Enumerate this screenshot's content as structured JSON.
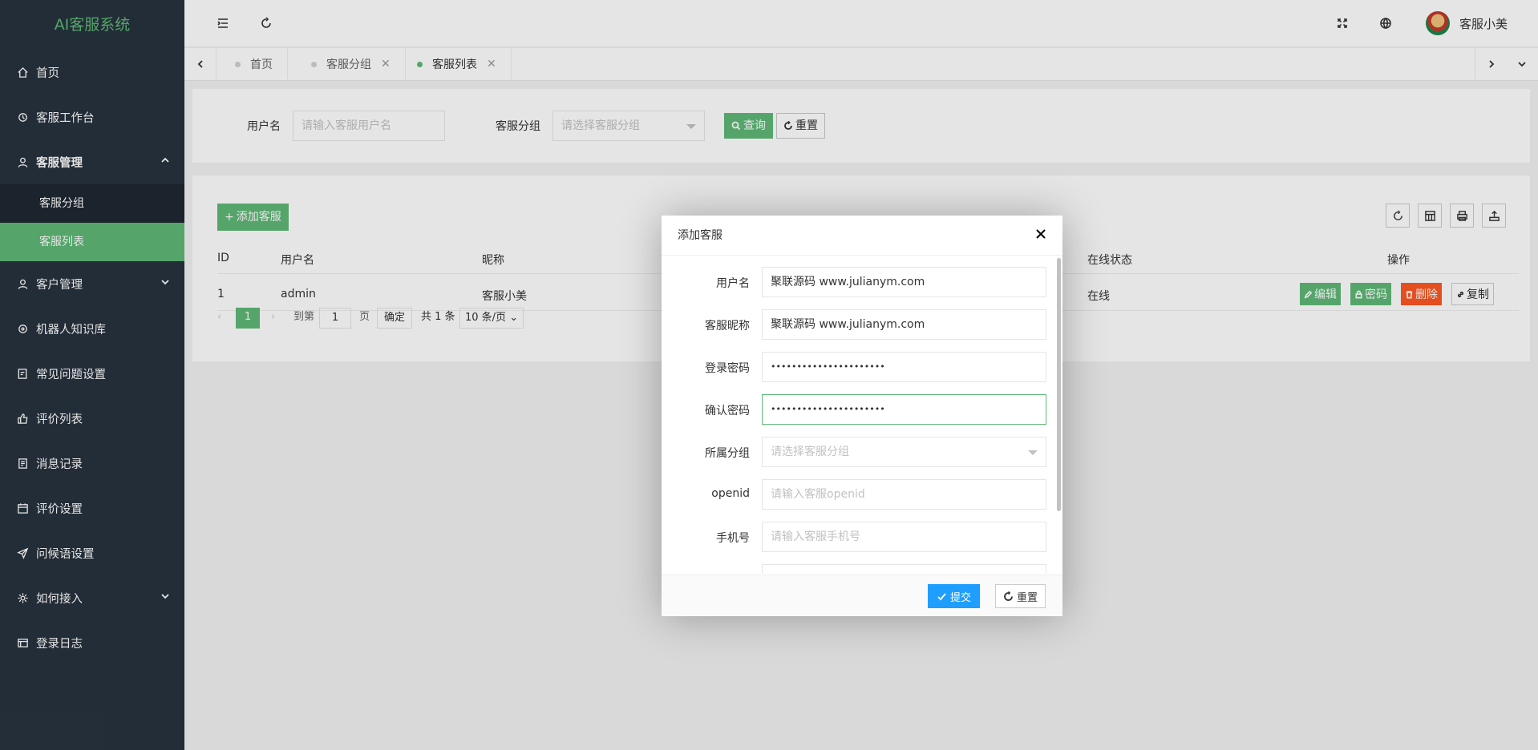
{
  "app": {
    "title": "AI客服系统"
  },
  "sidebar": {
    "items": [
      {
        "label": "首页",
        "icon": "home-icon"
      },
      {
        "label": "客服工作台",
        "icon": "workbench-icon"
      },
      {
        "label": "客服管理",
        "icon": "user-icon",
        "expanded": true,
        "children": [
          {
            "label": "客服分组"
          },
          {
            "label": "客服列表",
            "active": true
          }
        ]
      },
      {
        "label": "客户管理",
        "icon": "user-icon",
        "expanded": false
      },
      {
        "label": "机器人知识库",
        "icon": "robot-icon"
      },
      {
        "label": "常见问题设置",
        "icon": "question-icon"
      },
      {
        "label": "评价列表",
        "icon": "thumb-up-icon"
      },
      {
        "label": "消息记录",
        "icon": "message-icon"
      },
      {
        "label": "评价设置",
        "icon": "calendar-icon"
      },
      {
        "label": "问候语设置",
        "icon": "send-icon"
      },
      {
        "label": "如何接入",
        "icon": "gear-icon",
        "expanded": false
      },
      {
        "label": "登录日志",
        "icon": "log-icon"
      }
    ]
  },
  "header": {
    "user_name": "客服小美"
  },
  "tabs": [
    {
      "label": "首页",
      "closable": false,
      "active": false
    },
    {
      "label": "客服分组",
      "closable": true,
      "active": false
    },
    {
      "label": "客服列表",
      "closable": true,
      "active": true
    }
  ],
  "search": {
    "username_label": "用户名",
    "username_placeholder": "请输入客服用户名",
    "group_label": "客服分组",
    "group_placeholder": "请选择客服分组",
    "query_label": "查询",
    "reset_label": "重置"
  },
  "table": {
    "add_label": "添加客服",
    "columns": [
      "ID",
      "用户名",
      "昵称",
      "在线状态",
      "操作"
    ],
    "rows": [
      {
        "id": "1",
        "username": "admin",
        "nickname": "客服小美",
        "status": "在线"
      }
    ],
    "actions": [
      "编辑",
      "密码",
      "删除",
      "复制"
    ]
  },
  "pager": {
    "current": "1",
    "goto_label": "到第",
    "goto_value": "1",
    "page_unit": "页",
    "confirm": "确定",
    "total": "共 1 条",
    "per_page": "10 条/页"
  },
  "modal": {
    "title": "添加客服",
    "fields": [
      {
        "label": "用户名",
        "value": "聚联源码 www.julianym.com",
        "placeholder": ""
      },
      {
        "label": "客服昵称",
        "value": "聚联源码 www.julianym.com",
        "placeholder": ""
      },
      {
        "label": "登录密码",
        "value": "••••••••••••••••••••••",
        "placeholder": ""
      },
      {
        "label": "确认密码",
        "value": "••••••••••••••••••••••",
        "placeholder": ""
      },
      {
        "label": "所属分组",
        "value": "",
        "placeholder": "请选择客服分组"
      },
      {
        "label": "openid",
        "value": "",
        "placeholder": "请输入客服openid"
      },
      {
        "label": "手机号",
        "value": "",
        "placeholder": "请输入客服手机号"
      }
    ],
    "submit_label": "提交",
    "reset_label": "重置"
  },
  "colors": {
    "accent": "#5fb878",
    "sidebar": "#28333e",
    "primary_blue": "#1e9fff",
    "danger": "#ff5722"
  }
}
